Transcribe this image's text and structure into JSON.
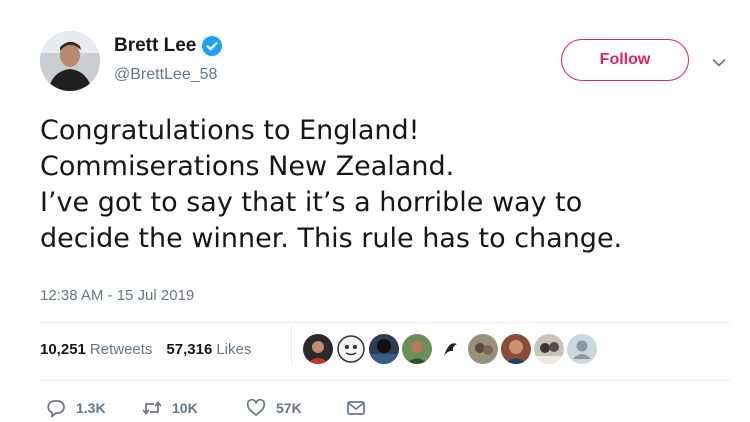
{
  "author": {
    "display_name": "Brett Lee",
    "handle": "@BrettLee_58",
    "verified": true
  },
  "follow_button": {
    "label": "Follow"
  },
  "tweet": {
    "lines": [
      "Congratulations to England!",
      "Commiserations New Zealand.",
      "I’ve got to say that it’s a horrible way to",
      "decide the winner. This rule has to change."
    ],
    "timestamp": "12:38 AM - 15 Jul 2019"
  },
  "stats": {
    "retweets": {
      "count": "10,251",
      "label": "Retweets"
    },
    "likes": {
      "count": "57,316",
      "label": "Likes"
    }
  },
  "actions": {
    "reply_count": "1.3K",
    "retweet_count": "10K",
    "like_count": "57K"
  },
  "colors": {
    "follow_accent": "#e0245e",
    "verified_blue": "#1da1f2",
    "secondary_text": "#657786"
  }
}
